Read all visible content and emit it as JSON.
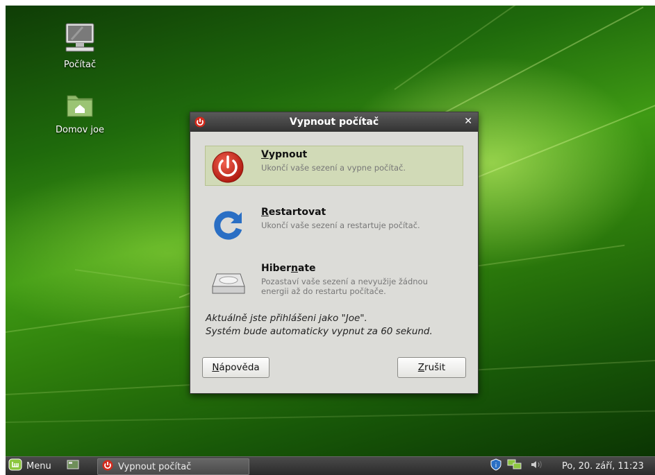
{
  "desktop": {
    "icons": [
      {
        "label": "Počítač",
        "icon": "computer-icon"
      },
      {
        "label": "Domov joe",
        "icon": "home-folder-icon"
      }
    ]
  },
  "dialog": {
    "title": "Vypnout počítač",
    "options": [
      {
        "label_pre": "",
        "label_key": "V",
        "label_post": "ypnout",
        "desc": "Ukončí vaše sezení a vypne počítač.",
        "icon": "power-icon",
        "selected": true
      },
      {
        "label_pre": "",
        "label_key": "R",
        "label_post": "estartovat",
        "desc": "Ukončí vaše sezení a restartuje počítač.",
        "icon": "restart-icon"
      },
      {
        "label_pre": "Hiber",
        "label_key": "n",
        "label_post": "ate",
        "desc_line1": "Pozastaví vaše sezení a nevyužije žádnou",
        "desc_line2": "energii až do restartu počítače.",
        "icon": "hard-drive-icon"
      }
    ],
    "info_line1": "Aktuálně jste přihlášeni jako \"Joe\".",
    "info_line2": "Systém bude automaticky vypnut za 60 sekund.",
    "help_key": "N",
    "help_rest": "ápověda",
    "cancel_key": "Z",
    "cancel_rest": "rušit"
  },
  "taskbar": {
    "menu_label": "Menu",
    "task_label": "Vypnout počítač",
    "clock": "Po, 20. září, 11:23"
  },
  "colors": {
    "selected_bg": "#d1dab7",
    "dialog_bg": "#dcdcd8",
    "power_red": "#d42a1c",
    "restart_blue": "#2a6fc4"
  }
}
